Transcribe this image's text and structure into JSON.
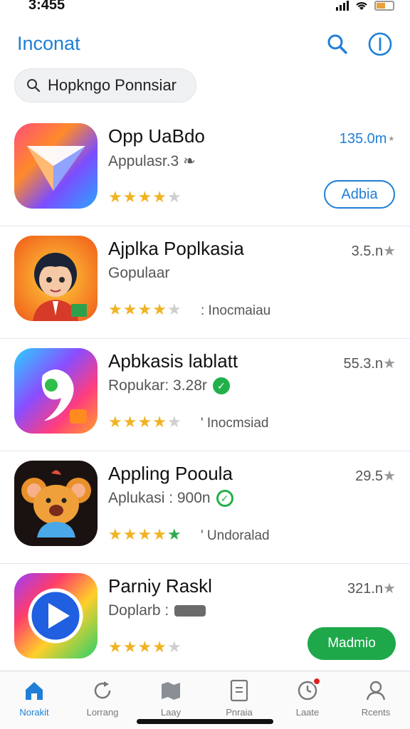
{
  "status_bar": {
    "time": "3:455"
  },
  "header": {
    "title": "Inconat"
  },
  "search": {
    "value": "Hopkngo Ponnsiar"
  },
  "apps": [
    {
      "name": "Opp UaBdo",
      "subtitle": "Appulasr.3 ❧",
      "size": "135.0m",
      "size_suffix": "⋆",
      "stars": [
        1,
        1,
        1,
        1,
        0
      ],
      "action": "Adbia",
      "status": ""
    },
    {
      "name": "Ajplka Poplkasia",
      "subtitle": "Gopulaar",
      "size": "3.5.n",
      "size_suffix": "★",
      "stars": [
        1,
        1,
        1,
        1,
        0
      ],
      "action": "",
      "status": ": Inocmaiau"
    },
    {
      "name": "Apbkasis lablatt",
      "subtitle": "Ropukar: 3.28r",
      "size": "55.3.n",
      "size_suffix": "★",
      "stars": [
        1,
        1,
        1,
        1,
        0
      ],
      "action": "",
      "status": "' Inocmsiad"
    },
    {
      "name": "Appling Pooula",
      "subtitle": "Aplukasi : 900n",
      "size": "29.5",
      "size_suffix": "★",
      "stars": [
        1,
        1,
        1,
        1,
        2
      ],
      "action": "",
      "status": "' Undoralad"
    },
    {
      "name": "Parniy Raskl",
      "subtitle": "Doplarb : ",
      "size": "321.n",
      "size_suffix": "★",
      "stars": [
        1,
        1,
        1,
        1,
        0
      ],
      "action": "Madmio",
      "status": ""
    }
  ],
  "tabs": [
    {
      "label": "Norakit",
      "icon": "home-icon",
      "active": true
    },
    {
      "label": "Lorrang",
      "icon": "refresh-icon",
      "active": false
    },
    {
      "label": "Laay",
      "icon": "map-icon",
      "active": false
    },
    {
      "label": "Pnraia",
      "icon": "document-icon",
      "active": false
    },
    {
      "label": "Laate",
      "icon": "clock-icon",
      "active": false
    },
    {
      "label": "Rcents",
      "icon": "profile-icon",
      "active": false
    }
  ],
  "colors": {
    "accent": "#1f7fd6",
    "green": "#1fa84a",
    "star": "#f0b323"
  }
}
